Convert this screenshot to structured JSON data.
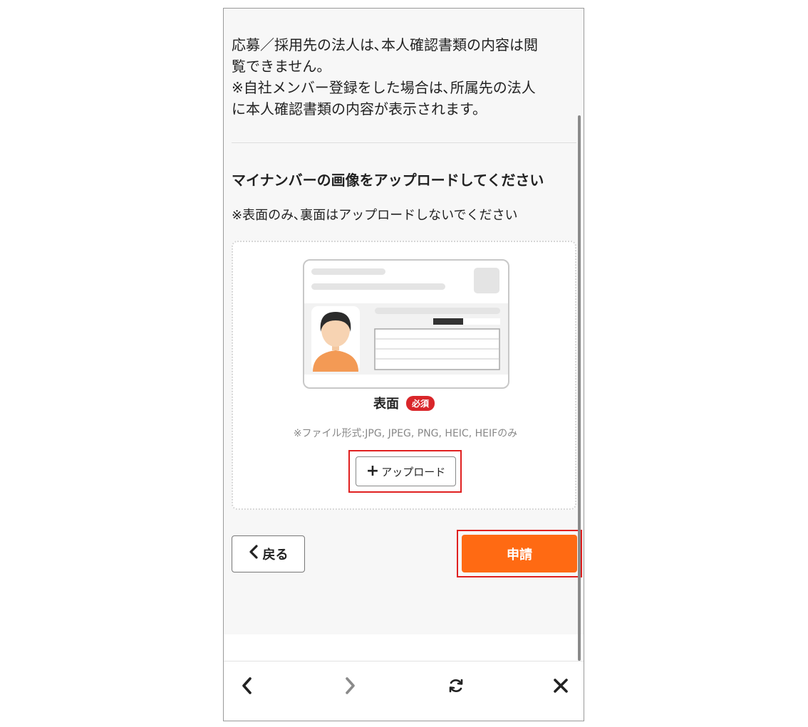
{
  "notice": {
    "lines": [
      "応募／採用先の法人は､本人確認書類の内容は閲",
      "覧できません。",
      "※自社メンバー登録をした場合は､所属先の法人",
      "に本人確認書類の内容が表示されます。"
    ]
  },
  "upload_section": {
    "heading": "マイナンバーの画像をアップロードしてください",
    "subnote": "※表面のみ､裏面はアップロードしないでください",
    "side_label": "表面",
    "required_badge": "必須",
    "format_note": "※ファイル形式:JPG, JPEG, PNG, HEIC, HEIFのみ",
    "upload_button": "アップロード",
    "upload_button_icon": "plus-icon"
  },
  "actions": {
    "back_label": "戻る",
    "submit_label": "申請"
  },
  "toolbar": {
    "back_icon": "‹",
    "forward_icon": "›",
    "refresh_icon": "⟳",
    "close_icon": "✕"
  },
  "colors": {
    "accent": "#ff6a13",
    "badge": "#d9262a",
    "highlight": "#e02020"
  }
}
